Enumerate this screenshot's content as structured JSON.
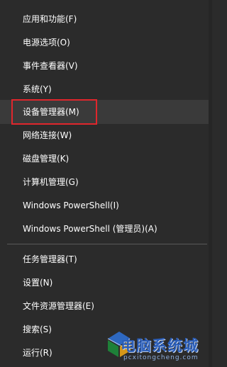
{
  "menu": {
    "items": [
      {
        "label": "应用和功能(F)"
      },
      {
        "label": "电源选项(O)"
      },
      {
        "label": "事件查看器(V)"
      },
      {
        "label": "系统(Y)"
      },
      {
        "label": "设备管理器(M)"
      },
      {
        "label": "网络连接(W)"
      },
      {
        "label": "磁盘管理(K)"
      },
      {
        "label": "计算机管理(G)"
      },
      {
        "label": "Windows PowerShell(I)"
      },
      {
        "label": "Windows PowerShell (管理员)(A)"
      },
      {
        "label": "任务管理器(T)"
      },
      {
        "label": "设置(N)"
      },
      {
        "label": "文件资源管理器(E)"
      },
      {
        "label": "搜索(S)"
      },
      {
        "label": "运行(R)"
      }
    ],
    "highlighted_item": "设备管理器(M)",
    "highlight_color": "#e0262c"
  },
  "watermark": {
    "text": "电脑系统城",
    "subtext": "pcxitongcheng.com",
    "icon": "windows-logo-icon"
  }
}
